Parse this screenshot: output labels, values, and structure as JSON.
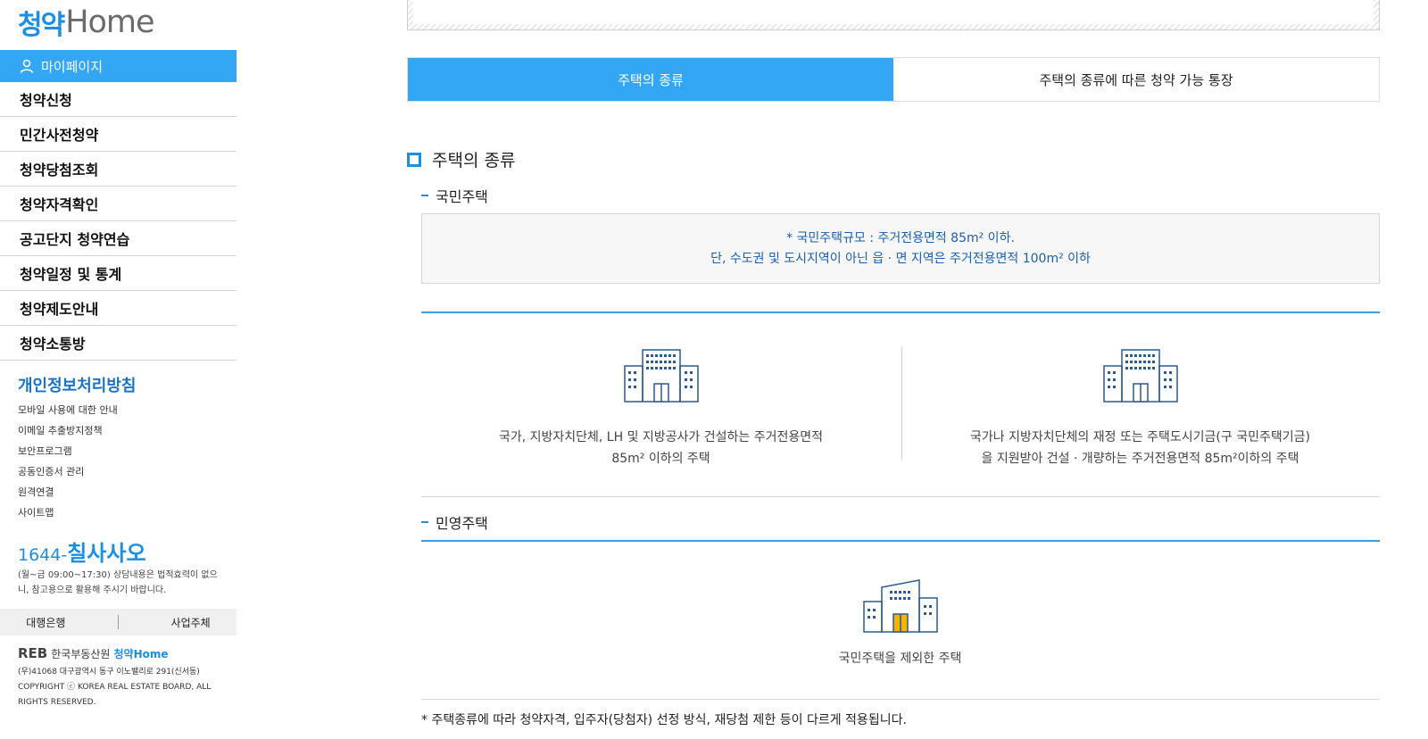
{
  "sidebar": {
    "logo_ko": "청약",
    "logo_en": "Home",
    "mypage": "마이페이지",
    "menu": [
      "청약신청",
      "민간사전청약",
      "청약당첨조회",
      "청약자격확인",
      "공고단지 청약연습",
      "청약일정 및 통계",
      "청약제도안내",
      "청약소통방"
    ],
    "privacy": "개인정보처리방침",
    "links": [
      "모바일 사용에 대한 안내",
      "이메일 추출방지정책",
      "보안프로그램",
      "공동인증서 관리",
      "원격연결",
      "사이트맵"
    ],
    "phone_prefix": "1644-",
    "phone_name": "칠사사오",
    "hours": "(월~금 09:00~17:30) 상담내용은 법적효력이 없으니, 참고용으로 활용해 주시기 바랍니다.",
    "bank": "대행은행",
    "business": "사업주체",
    "reb_mark": "REB",
    "reb_name": "한국부동산원",
    "reb_ch": "청약Home",
    "address": "(우)41068 대구광역시 동구 이노밸리로 291(신서동)",
    "copyright": "COPYRIGHT ⓒ KOREA REAL ESTATE BOARD, ALL RIGHTS RESERVED."
  },
  "tabs": {
    "active": "주택의 종류",
    "inactive": "주택의 종류에 따른 청약 가능 통장"
  },
  "main": {
    "section_title": "주택의 종류",
    "national": {
      "title": "국민주택",
      "note_line1": "* 국민주택규모 : 주거전용면적 85m² 이하.",
      "note_line2": "단, 수도권 및 도시지역이 아닌 읍 · 면 지역은 주거전용면적 100m² 이하",
      "card1_line1": "국가, 지방자치단체, LH 및 지방공사가 건설하는 주거전용면적",
      "card1_line2": "85m² 이하의 주택",
      "card2_line1": "국가나 지방자치단체의 재정 또는 주택도시기금(구 국민주택기금)",
      "card2_line2": "을 지원받아 건설 · 개량하는 주거전용면적 85m²이하의 주택"
    },
    "private": {
      "title": "민영주택",
      "card_text": "국민주택을 제외한 주택"
    },
    "footnote": "* 주택종류에 따라 청약자격, 입주자(당첨자) 선정 방식, 재당첨 제한 등이 다르게 적용됩니다."
  },
  "colors": {
    "accent": "#33a7f4",
    "door_private": "#f5b400"
  },
  "icons": {
    "building": "building-icon",
    "person": "person-icon"
  }
}
